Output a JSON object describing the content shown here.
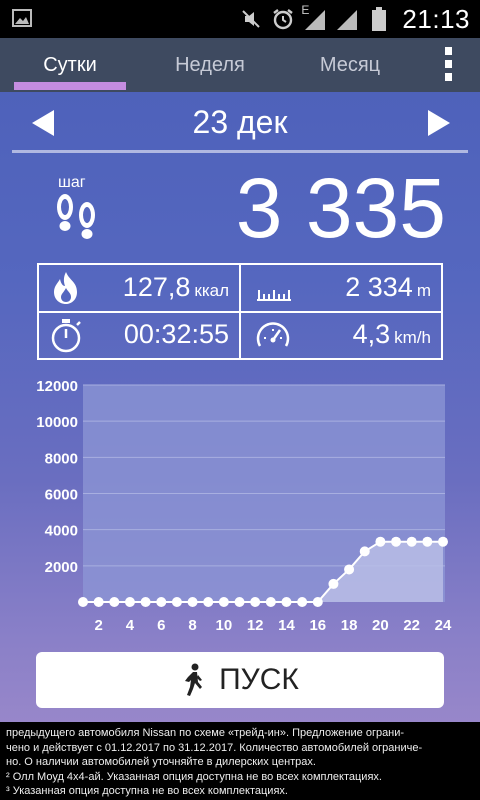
{
  "status_bar": {
    "time": "21:13",
    "network_type": "E",
    "icons": [
      "image-icon",
      "mute-icon",
      "alarm-icon",
      "signal-icon",
      "signal-icon",
      "battery-icon"
    ]
  },
  "tabs": [
    {
      "label": "Сутки",
      "active": true
    },
    {
      "label": "Неделя",
      "active": false
    },
    {
      "label": "Месяц",
      "active": false
    }
  ],
  "date": "23 дек",
  "steps": {
    "label": "шаг",
    "value": "3 335"
  },
  "stats": {
    "calories": {
      "value": "127,8",
      "unit": "ккал"
    },
    "distance": {
      "value": "2 334",
      "unit": "m"
    },
    "duration": {
      "value": "00:32:55",
      "unit": ""
    },
    "speed": {
      "value": "4,3",
      "unit": "km/h"
    }
  },
  "chart_data": {
    "type": "line",
    "x": [
      1,
      2,
      3,
      4,
      5,
      6,
      7,
      8,
      9,
      10,
      11,
      12,
      13,
      14,
      15,
      16,
      17,
      18,
      19,
      20,
      21,
      22,
      23,
      24
    ],
    "values": [
      0,
      0,
      0,
      0,
      0,
      0,
      0,
      0,
      0,
      0,
      0,
      0,
      0,
      0,
      0,
      0,
      1000,
      1800,
      2800,
      3335,
      3335,
      3335,
      3335,
      3335
    ],
    "x_tick_labels": [
      "2",
      "4",
      "6",
      "8",
      "10",
      "12",
      "14",
      "16",
      "18",
      "20",
      "22",
      "24"
    ],
    "y_tick_labels": [
      "12000",
      "10000",
      "8000",
      "6000",
      "4000",
      "2000"
    ],
    "ylim": [
      0,
      12000
    ],
    "grid": true,
    "colors": {
      "line": "#ffffff",
      "fill": "#b8bde6",
      "plot_bg": "#8e97d6"
    }
  },
  "start_button": {
    "label": "ПУСК"
  },
  "footer_lines": [
    "предыдущего автомобиля Nissan по схеме «трейд-ин». Предложение ограни-",
    "чено и действует с 01.12.2017 по 31.12.2017. Количество автомобилей ограниче-",
    "но. О наличии автомобилей уточняйте в дилерских центрах.",
    "² Олл Моуд 4х4-ай. Указанная опция доступна не во всех комплектациях.",
    "³ Указанная опция доступна не во всех комплектациях."
  ]
}
